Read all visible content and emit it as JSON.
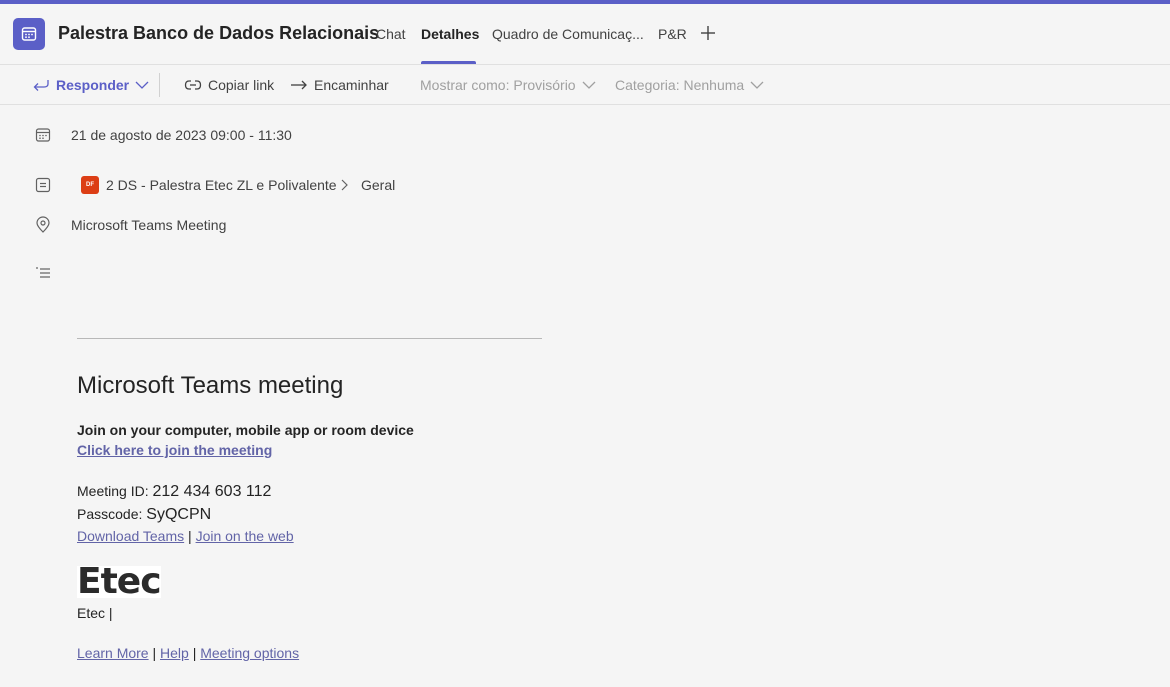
{
  "header": {
    "title": "Palestra Banco de Dados Relacionais",
    "tabs": [
      {
        "label": "Chat"
      },
      {
        "label": "Detalhes"
      },
      {
        "label": "Quadro de Comunicaç..."
      },
      {
        "label": "P&R"
      }
    ],
    "active_tab": "Detalhes",
    "accent_color": "#5b5fc7"
  },
  "toolbar": {
    "respond_label": "Responder",
    "copy_link_label": "Copiar link",
    "forward_label": "Encaminhar",
    "show_as_label": "Mostrar como: Provisório",
    "category_label": "Categoria: Nenhuma"
  },
  "details": {
    "datetime": "21 de agosto de 2023 09:00 - 11:30",
    "channel_badge": "DF",
    "team": "2 DS - Palestra Etec ZL e Polivalente",
    "channel": "Geral",
    "location": "Microsoft Teams Meeting"
  },
  "body": {
    "meeting_title": "Microsoft Teams meeting",
    "join_heading": "Join on your computer, mobile app or room device",
    "join_link": "Click here to join the meeting",
    "meeting_id_label": "Meeting ID: ",
    "meeting_id": "212 434 603 112",
    "passcode_label": "Passcode: ",
    "passcode": "SyQCPN",
    "download_link": "Download Teams",
    "separator": "|",
    "web_link": "Join on the web",
    "logo_text": "Etec",
    "org_text": "Etec |",
    "learn_more": "Learn More",
    "help": "Help",
    "meeting_options": "Meeting options"
  }
}
